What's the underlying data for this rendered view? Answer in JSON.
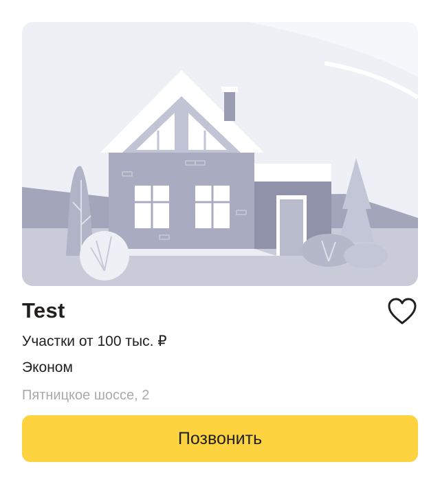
{
  "listing": {
    "title": "Test",
    "price": "Участки от 100 тыс. ₽",
    "class": "Эконом",
    "address": "Пятницкое шоссе, 2",
    "call_label": "Позвонить",
    "favorite_icon": "heart-outline-icon",
    "image": "house-placeholder-illustration"
  },
  "colors": {
    "accent": "#fdd33f",
    "text": "#21201f",
    "muted": "#a9a9ae"
  }
}
